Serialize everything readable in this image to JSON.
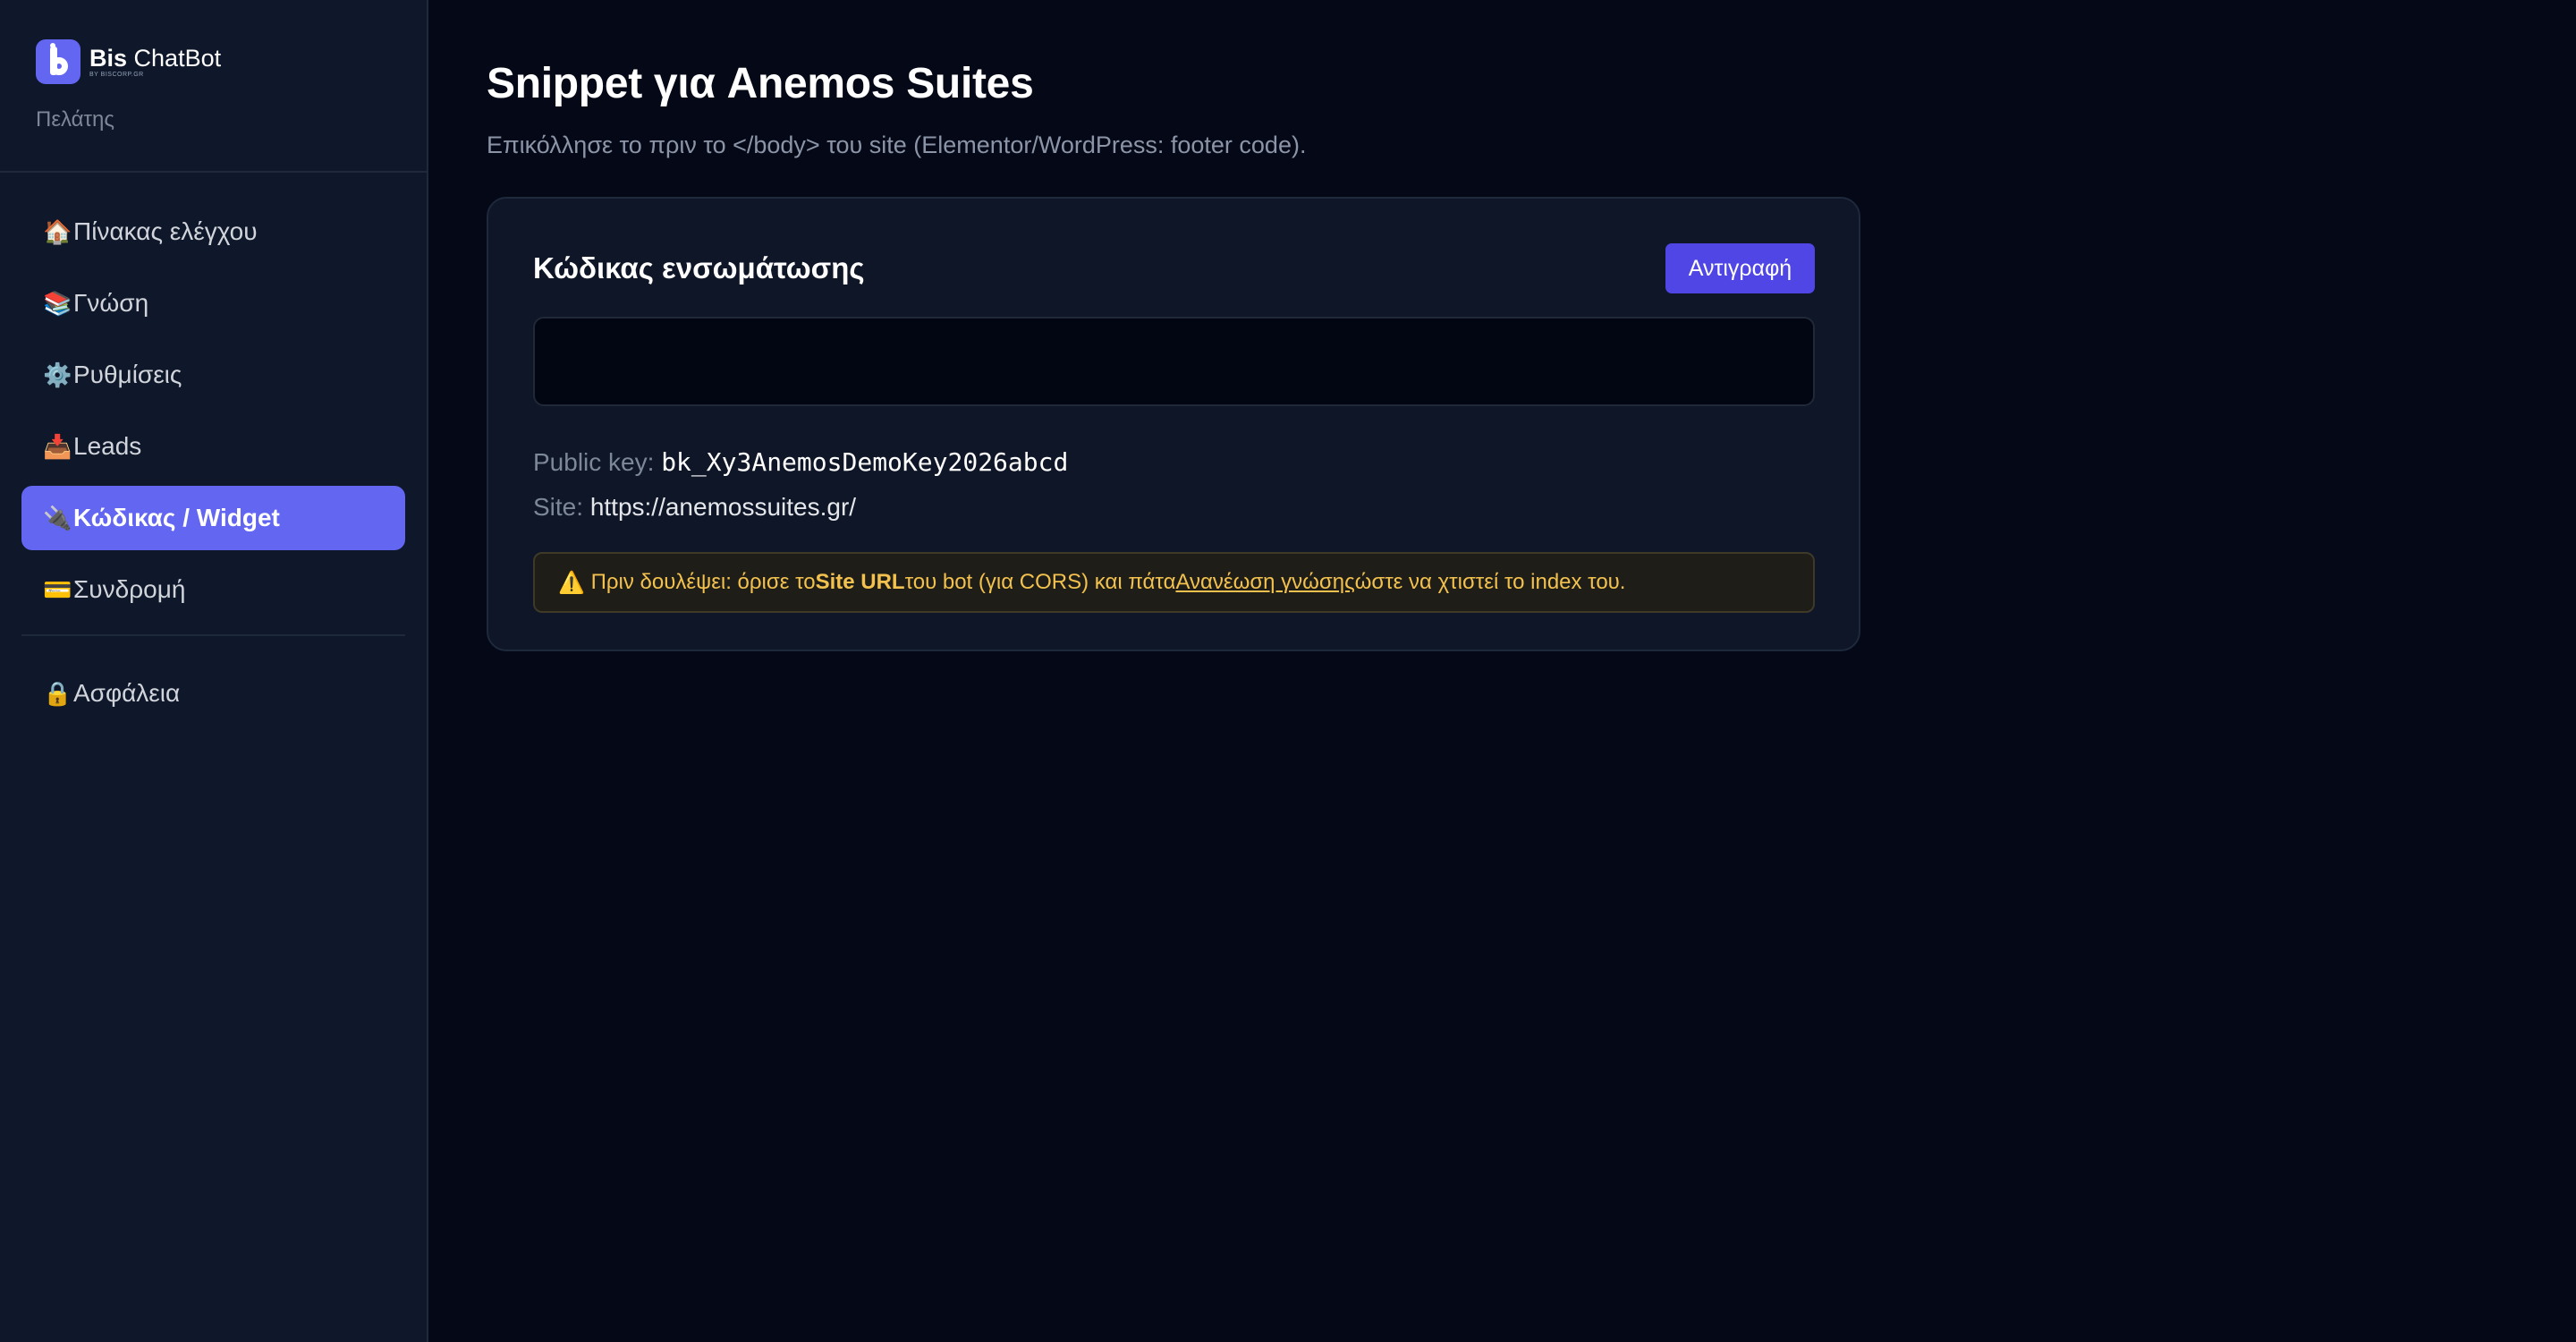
{
  "brand": {
    "name_bold": "Bis",
    "name_rest": " ChatBot",
    "subtitle": "BY BISCORP.GR",
    "role": "Πελάτης"
  },
  "sidebar": {
    "items": [
      {
        "icon": "🏠",
        "icon_name": "house-icon",
        "label": "Πίνακας ελέγχου"
      },
      {
        "icon": "📚",
        "icon_name": "books-icon",
        "label": "Γνώση"
      },
      {
        "icon": "⚙️",
        "icon_name": "gear-icon",
        "label": "Ρυθμίσεις"
      },
      {
        "icon": "📥",
        "icon_name": "inbox-tray-icon",
        "label": "Leads"
      },
      {
        "icon": "🔌",
        "icon_name": "plug-icon",
        "label": "Κώδικας / Widget",
        "active": true
      },
      {
        "icon": "💳",
        "icon_name": "credit-card-icon",
        "label": "Συνδρομή"
      },
      {
        "icon": "🔒",
        "icon_name": "lock-icon",
        "label": "Ασφάλεια"
      }
    ]
  },
  "main": {
    "title": "Snippet για Anemos Suites",
    "subtitle": "Επικόλλησε το πριν το </body> του site (Elementor/WordPress: footer code).",
    "card": {
      "title": "Κώδικας ενσωμάτωσης",
      "copy_label": "Αντιγραφή",
      "code": "",
      "public_key_label": "Public key:",
      "public_key": "bk_Xy3AnemosDemoKey2026abcd",
      "site_label": "Site:",
      "site": "https://anemossuites.gr/",
      "warning": {
        "icon": "⚠️",
        "icon_name": "warning-icon",
        "text1": "Πριν δουλέψει: όρισε το ",
        "bold": "Site URL",
        "text2": " του bot (για CORS) και πάτα ",
        "link": "Ανανέωση γνώσης",
        "text3": " ώστε να χτιστεί το index του."
      }
    }
  },
  "colors": {
    "background": "#050816",
    "sidebar": "#0f172a",
    "accent": "#6366f1",
    "button": "#4f46e5",
    "warning_text": "#f2c14e"
  }
}
